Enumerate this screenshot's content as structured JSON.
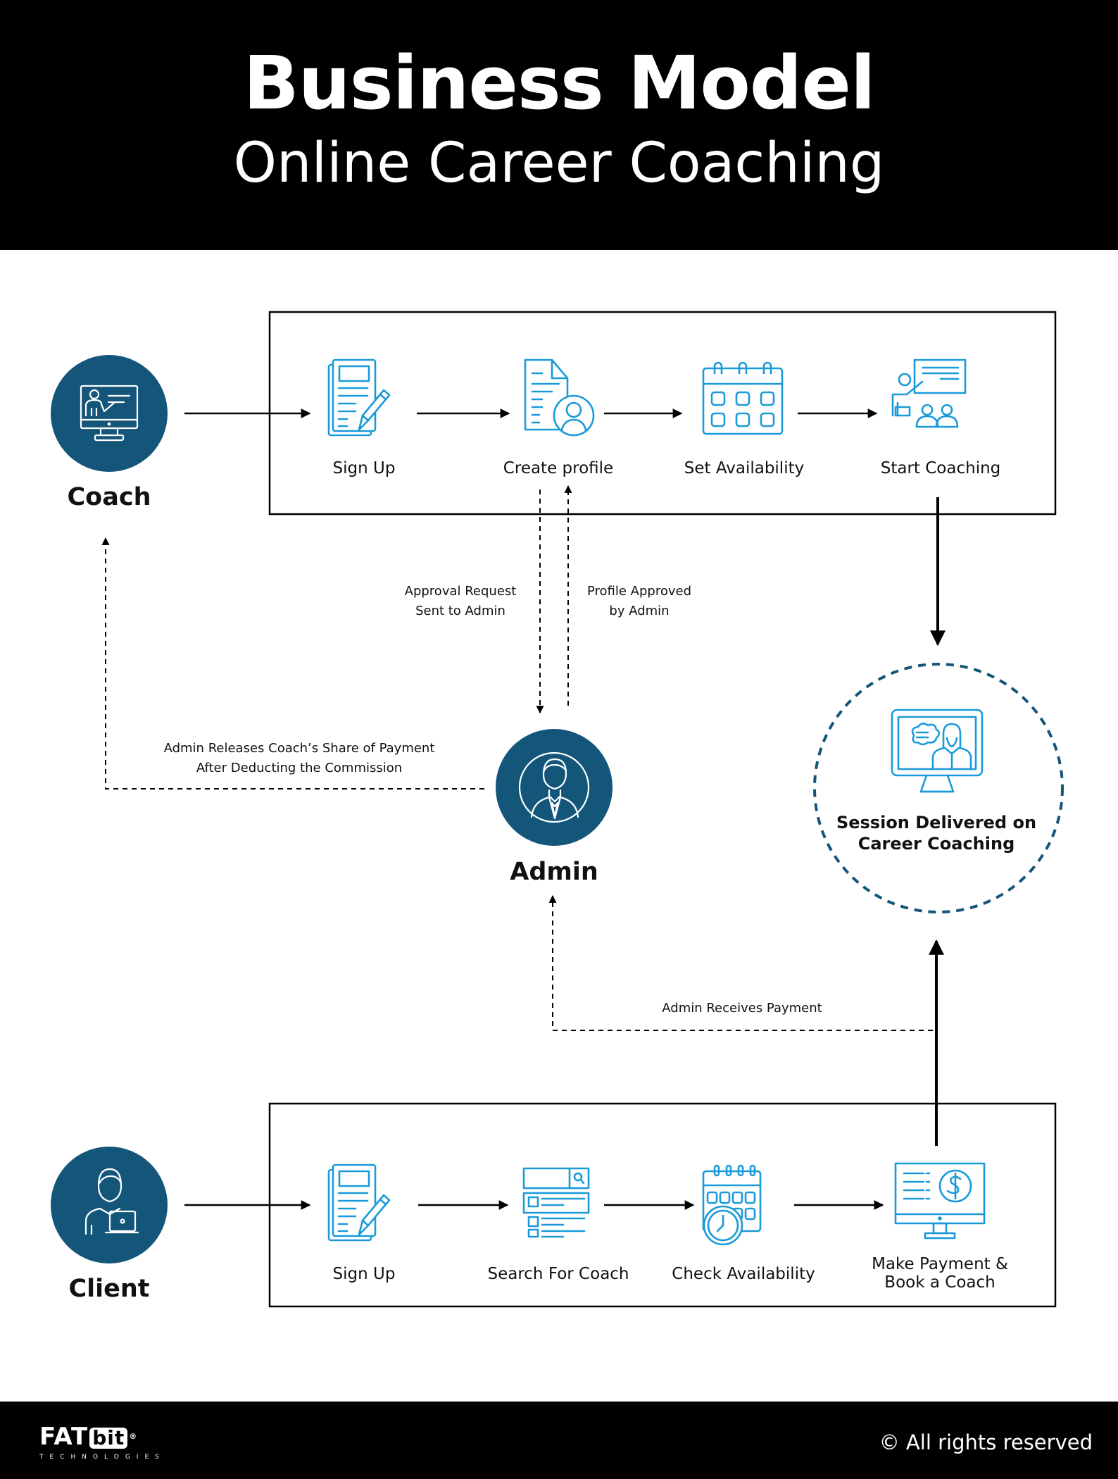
{
  "header": {
    "title": "Business Model",
    "subtitle": "Online Career Coaching"
  },
  "colors": {
    "header_bg": "#000000",
    "actor_circle": "#14567a",
    "icon_blue": "#1a9ad9",
    "session_border": "#14567a",
    "line": "#000000"
  },
  "actors": {
    "coach": {
      "label": "Coach",
      "icon": "teacher-monitor-icon"
    },
    "admin": {
      "label": "Admin",
      "icon": "businessman-avatar-icon"
    },
    "client": {
      "label": "Client",
      "icon": "user-laptop-icon"
    }
  },
  "coach_flow": {
    "steps": [
      {
        "label": "Sign Up",
        "icon": "signup-form-icon"
      },
      {
        "label": "Create profile",
        "icon": "profile-document-icon"
      },
      {
        "label": "Set Availability",
        "icon": "calendar-icon"
      },
      {
        "label": "Start Coaching",
        "icon": "presentation-icon"
      }
    ]
  },
  "client_flow": {
    "steps": [
      {
        "label": "Sign Up",
        "icon": "signup-form-icon"
      },
      {
        "label": "Search For Coach",
        "icon": "search-list-icon"
      },
      {
        "label": "Check Availability",
        "icon": "calendar-clock-icon"
      },
      {
        "label_line1": "Make Payment &",
        "label_line2": "Book a Coach",
        "icon": "payment-monitor-icon"
      }
    ]
  },
  "flows": {
    "approval_request": {
      "line1": "Approval Request",
      "line2": "Sent to Admin"
    },
    "profile_approved": {
      "line1": "Profile Approved",
      "line2": "by Admin"
    },
    "admin_releases": {
      "line1": "Admin Releases Coach’s Share of Payment",
      "line2": "After Deducting the Commission"
    },
    "admin_receives": {
      "line1": "Admin Receives Payment"
    }
  },
  "session": {
    "line1": "Session Delivered on",
    "line2": "Career Coaching",
    "icon": "online-session-monitor-icon"
  },
  "footer": {
    "logo_fat": "FAT",
    "logo_bit": "bit",
    "logo_reg": "®",
    "logo_sub": "TECHNOLOGIES",
    "copyright": "© All rights reserved"
  }
}
